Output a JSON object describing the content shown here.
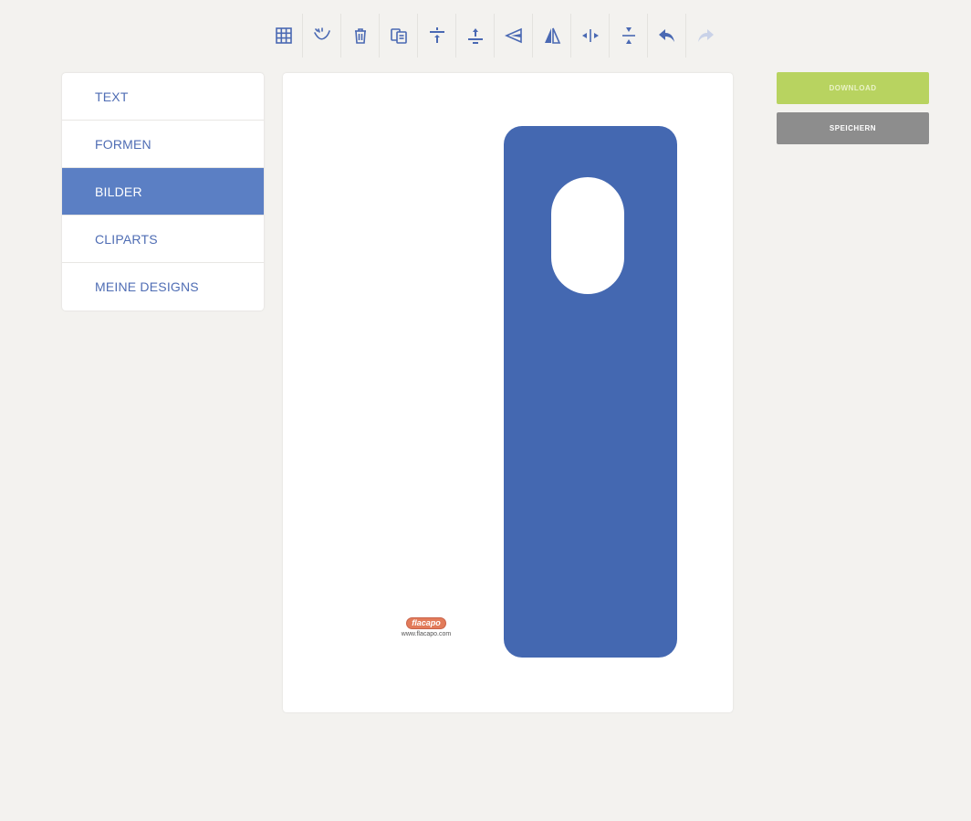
{
  "toolbar": {
    "tools": [
      {
        "icon": "grid-icon"
      },
      {
        "icon": "magic-wand-icon"
      },
      {
        "icon": "trash-icon"
      },
      {
        "icon": "duplicate-icon"
      },
      {
        "icon": "bring-forward-icon"
      },
      {
        "icon": "send-backward-icon"
      },
      {
        "icon": "flip-horizontal-icon"
      },
      {
        "icon": "flip-vertical-icon"
      },
      {
        "icon": "center-horizontal-icon"
      },
      {
        "icon": "center-vertical-icon"
      },
      {
        "icon": "undo-icon"
      },
      {
        "icon": "redo-icon",
        "disabled": true
      }
    ]
  },
  "menu": {
    "items": [
      {
        "label": "TEXT"
      },
      {
        "label": "FORMEN"
      },
      {
        "label": "BILDER",
        "active": true
      },
      {
        "label": "CLIPARTS"
      },
      {
        "label": "MEINE DESIGNS"
      }
    ]
  },
  "canvas": {
    "watermark": {
      "logo_text": "flacapo",
      "url": "www.flacapo.com"
    },
    "shape": {
      "name": "door hanger",
      "color": "#4468b1"
    }
  },
  "actions": {
    "download_label": "DOWNLOAD",
    "save_label": "SPEICHERN"
  },
  "colors": {
    "accent": "#5b7fc4",
    "download": "#b8d360",
    "save": "#8d8d8d",
    "background": "#f3f2ef"
  }
}
